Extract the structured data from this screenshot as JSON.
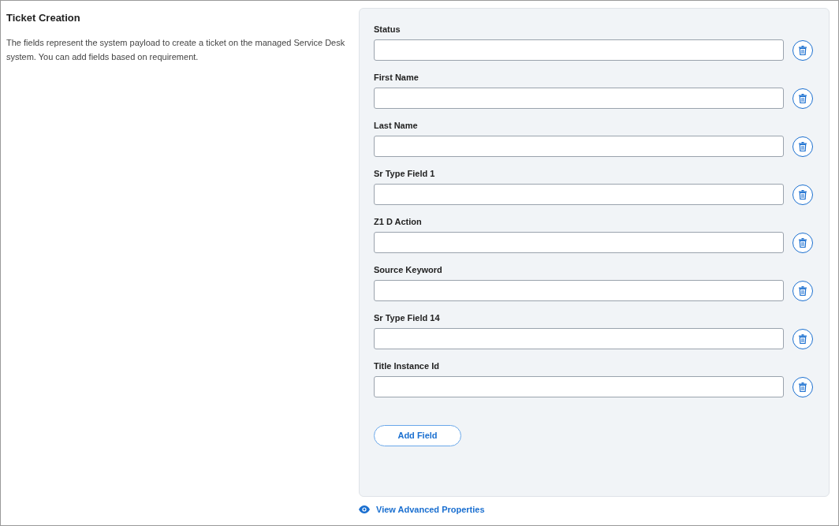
{
  "section": {
    "title": "Ticket Creation",
    "description": "The fields represent the system payload to create a ticket on the managed Service Desk system. You can add fields based on requirement."
  },
  "fields": [
    {
      "label": "Status"
    },
    {
      "label": "First Name"
    },
    {
      "label": "Last Name"
    },
    {
      "label": "Sr Type Field 1"
    },
    {
      "label": "Z1 D Action"
    },
    {
      "label": "Source Keyword"
    },
    {
      "label": "Sr Type Field 14"
    },
    {
      "label": "Title Instance Id"
    }
  ],
  "add_button": "Add Field",
  "advanced_link": "View Advanced Properties"
}
